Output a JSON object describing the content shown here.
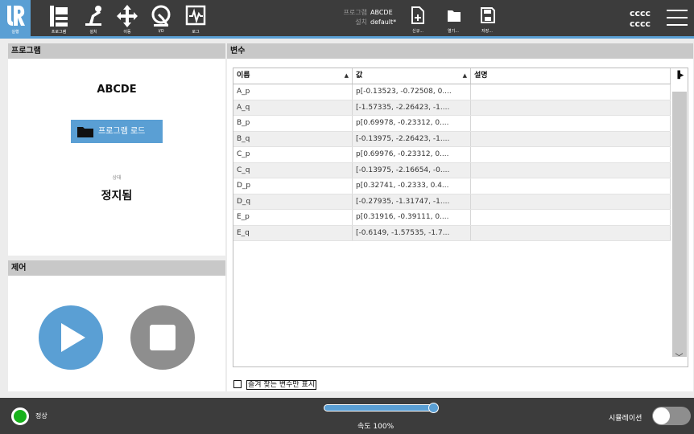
{
  "header": {
    "nav": [
      {
        "label": "실행",
        "icon": "ur-logo-icon"
      },
      {
        "label": "프로그램",
        "icon": "program-icon"
      },
      {
        "label": "설치",
        "icon": "robot-arm-icon"
      },
      {
        "label": "이동",
        "icon": "move-arrows-icon"
      },
      {
        "label": "I/O",
        "icon": "io-icon"
      },
      {
        "label": "로그",
        "icon": "log-icon"
      }
    ],
    "program_label": "프로그램",
    "program_name": "ABCDE",
    "install_label": "설치",
    "install_name": "default*",
    "new_label": "신규...",
    "open_label": "열기...",
    "save_label": "저장...",
    "user_line1": "cccc",
    "user_line2": "cccc"
  },
  "left": {
    "program_title": "프로그램",
    "program_name": "ABCDE",
    "load_button": "프로그램 로드",
    "state_label": "상태",
    "state_value": "정지됨",
    "control_title": "제어"
  },
  "variables": {
    "title": "변수",
    "columns": [
      "이름",
      "값",
      "설명"
    ],
    "rows": [
      {
        "name": "A_p",
        "value": "p[-0.13523, -0.72508, 0....",
        "desc": ""
      },
      {
        "name": "A_q",
        "value": "[-1.57335, -2.26423, -1....",
        "desc": ""
      },
      {
        "name": "B_p",
        "value": "p[0.69978, -0.23312, 0....",
        "desc": ""
      },
      {
        "name": "B_q",
        "value": "[-0.13975, -2.26423, -1....",
        "desc": ""
      },
      {
        "name": "C_p",
        "value": "p[0.69976, -0.23312, 0....",
        "desc": ""
      },
      {
        "name": "C_q",
        "value": "[-0.13975, -2.16654, -0....",
        "desc": ""
      },
      {
        "name": "D_p",
        "value": "p[0.32741, -0.2333, 0.4...",
        "desc": ""
      },
      {
        "name": "D_q",
        "value": "[-0.27935, -1.31747, -1....",
        "desc": ""
      },
      {
        "name": "E_p",
        "value": "p[0.31916, -0.39111, 0....",
        "desc": ""
      },
      {
        "name": "E_q",
        "value": "[-0.6149, -1.57535, -1.7...",
        "desc": ""
      }
    ],
    "favorites_label": "즐겨 찾는 변수만 표시"
  },
  "footer": {
    "status": "정상",
    "speed": "속도 100%",
    "speed_fraction": 1.0,
    "simulation": "시뮬레이션"
  },
  "colors": {
    "accent": "#5a9fd4",
    "header": "#3c3c3c",
    "status_ok": "#17b11b"
  }
}
